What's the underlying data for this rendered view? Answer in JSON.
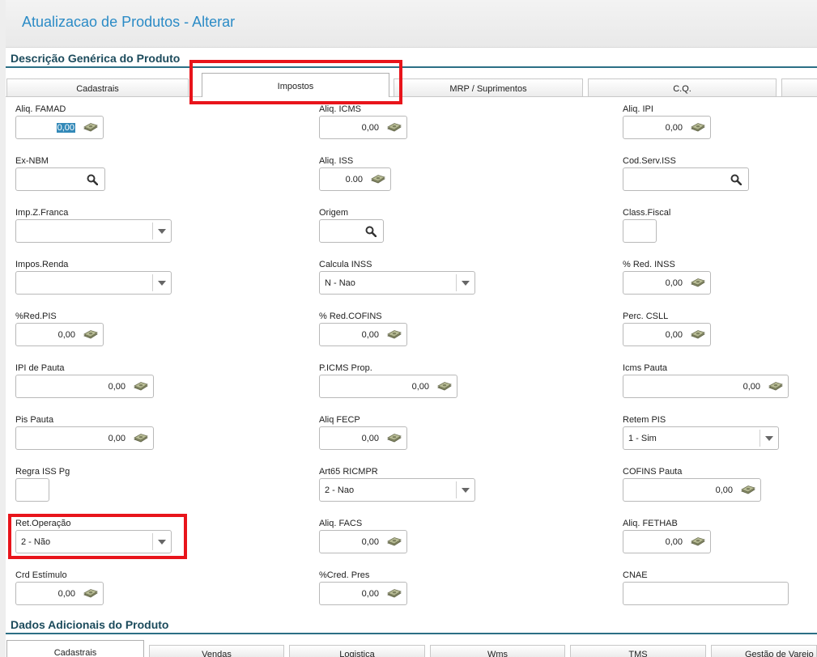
{
  "window": {
    "title": "Atualizacao de Produtos - Alterar"
  },
  "section1": {
    "title": "Descrição Genérica do Produto"
  },
  "section2": {
    "title": "Dados Adicionais do Produto"
  },
  "tabs_top": [
    "Cadastrais",
    "Impostos",
    "MRP / Suprimentos",
    "C.Q.",
    ""
  ],
  "tabs_bottom": [
    "Cadastrais",
    "Vendas",
    "Logistica",
    "Wms",
    "TMS",
    "Gestão de Varejo"
  ],
  "fields": {
    "aliq_famad": {
      "label": "Aliq. FAMAD",
      "value": "0,00"
    },
    "aliq_icms": {
      "label": "Aliq. ICMS",
      "value": "0,00"
    },
    "aliq_ipi": {
      "label": "Aliq. IPI",
      "value": "0,00"
    },
    "ex_nbm": {
      "label": "Ex-NBM",
      "value": ""
    },
    "aliq_iss": {
      "label": "Aliq. ISS",
      "value": "0.00"
    },
    "cod_serv_iss": {
      "label": "Cod.Serv.ISS",
      "value": ""
    },
    "imp_z_franca": {
      "label": "Imp.Z.Franca",
      "value": ""
    },
    "origem": {
      "label": "Origem",
      "value": ""
    },
    "class_fiscal": {
      "label": "Class.Fiscal",
      "value": ""
    },
    "impos_renda": {
      "label": "Impos.Renda",
      "value": ""
    },
    "calcula_inss": {
      "label": "Calcula INSS",
      "value": "N - Nao"
    },
    "red_inss": {
      "label": "% Red. INSS",
      "value": "0,00"
    },
    "red_pis": {
      "label": "%Red.PIS",
      "value": "0,00"
    },
    "red_cofins": {
      "label": "% Red.COFINS",
      "value": "0,00"
    },
    "perc_csll": {
      "label": "Perc. CSLL",
      "value": "0,00"
    },
    "ipi_pauta": {
      "label": "IPI de Pauta",
      "value": "0,00"
    },
    "picms_prop": {
      "label": "P.ICMS Prop.",
      "value": "0,00"
    },
    "icms_pauta": {
      "label": "Icms Pauta",
      "value": "0,00"
    },
    "pis_pauta": {
      "label": "Pis Pauta",
      "value": "0,00"
    },
    "aliq_fecp": {
      "label": "Aliq FECP",
      "value": "0,00"
    },
    "retem_pis": {
      "label": "Retem PIS",
      "value": "1 - Sim"
    },
    "regra_iss_pg": {
      "label": "Regra ISS Pg",
      "value": ""
    },
    "art65_ricmpr": {
      "label": "Art65 RICMPR",
      "value": "2 - Nao"
    },
    "cofins_pauta": {
      "label": "COFINS Pauta",
      "value": "0,00"
    },
    "ret_operacao": {
      "label": "Ret.Operação",
      "value": "2 - Não"
    },
    "aliq_facs": {
      "label": "Aliq. FACS",
      "value": "0,00"
    },
    "aliq_fethab": {
      "label": "Aliq. FETHAB",
      "value": "0,00"
    },
    "crd_estimulo": {
      "label": "Crd Estímulo",
      "value": "0,00"
    },
    "cred_pres": {
      "label": "%Cred. Pres",
      "value": "0,00"
    },
    "cnae": {
      "label": "CNAE",
      "value": ""
    }
  },
  "icons": {
    "money": "money-icon",
    "lookup": "magnifier-icon",
    "dropdown": "chevron-down-icon"
  },
  "colors": {
    "title": "#2b8bc6",
    "section": "#1c4b5c",
    "highlight": "#e8141b",
    "selection": "#3389b8"
  }
}
